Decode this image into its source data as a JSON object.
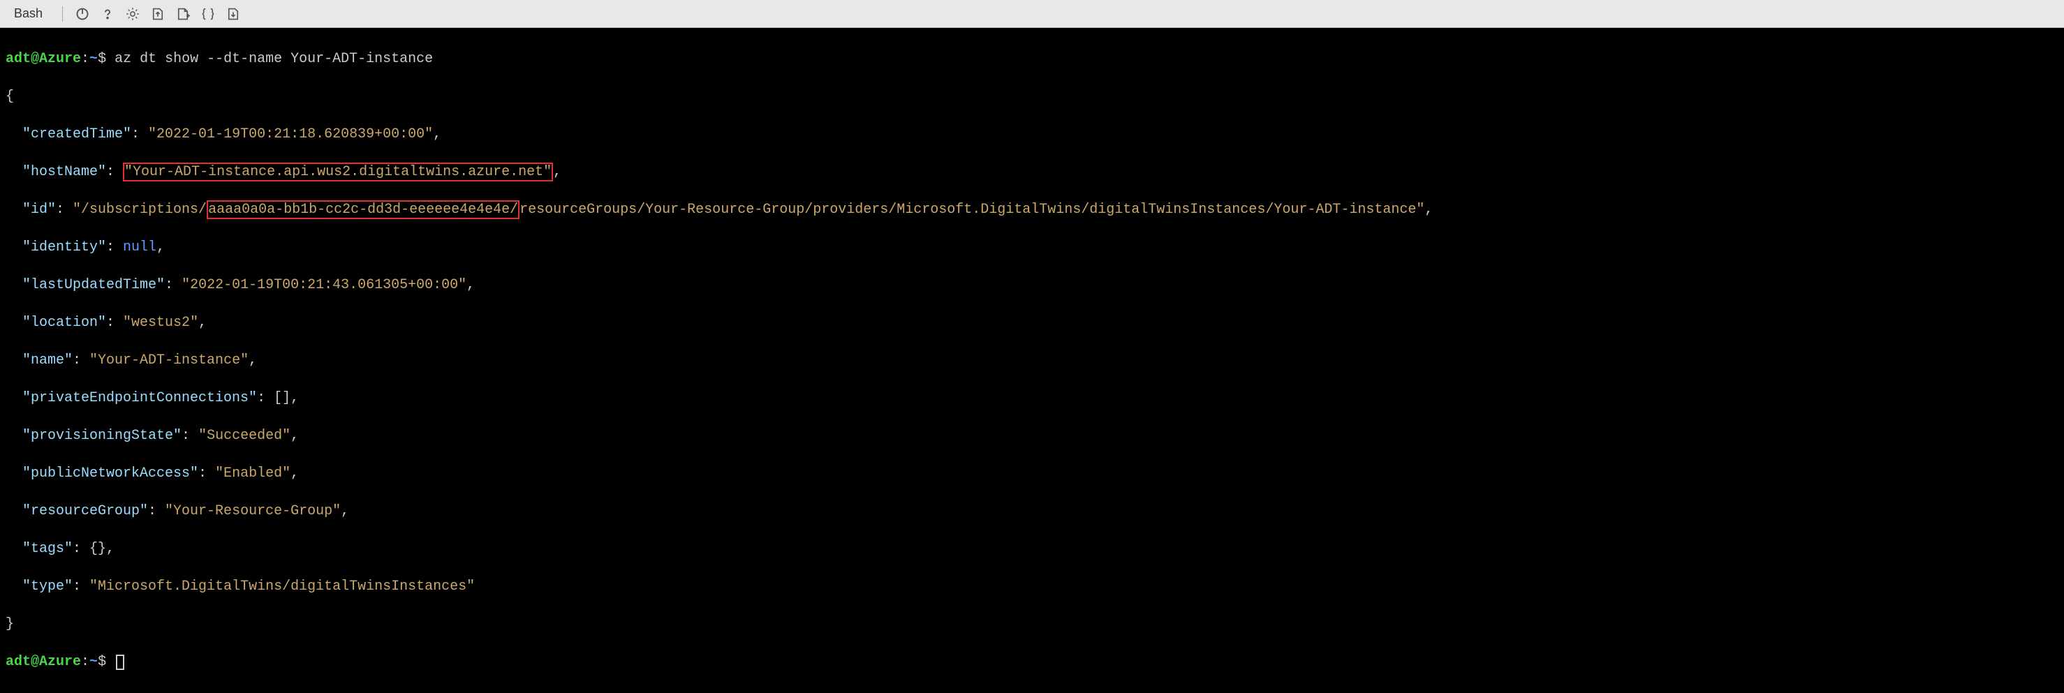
{
  "toolbar": {
    "shell_label": "Bash"
  },
  "prompt": {
    "user_host": "adt@Azure",
    "path": "~",
    "symbol": "$"
  },
  "command": "az dt show --dt-name Your-ADT-instance",
  "output": {
    "createdTime_key": "\"createdTime\"",
    "createdTime_val": "\"2022-01-19T00:21:18.620839+00:00\"",
    "hostName_key": "\"hostName\"",
    "hostName_val": "\"Your-ADT-instance.api.wus2.digitaltwins.azure.net\"",
    "id_key": "\"id\"",
    "id_prefix": "\"/subscriptions/",
    "id_highlight": "aaaa0a0a-bb1b-cc2c-dd3d-eeeeee4e4e4e/",
    "id_suffix": "resourceGroups/Your-Resource-Group/providers/Microsoft.DigitalTwins/digitalTwinsInstances/Your-ADT-instance\"",
    "identity_key": "\"identity\"",
    "identity_val": "null",
    "lastUpdatedTime_key": "\"lastUpdatedTime\"",
    "lastUpdatedTime_val": "\"2022-01-19T00:21:43.061305+00:00\"",
    "location_key": "\"location\"",
    "location_val": "\"westus2\"",
    "name_key": "\"name\"",
    "name_val": "\"Your-ADT-instance\"",
    "privateEndpointConnections_key": "\"privateEndpointConnections\"",
    "privateEndpointConnections_val": "[]",
    "provisioningState_key": "\"provisioningState\"",
    "provisioningState_val": "\"Succeeded\"",
    "publicNetworkAccess_key": "\"publicNetworkAccess\"",
    "publicNetworkAccess_val": "\"Enabled\"",
    "resourceGroup_key": "\"resourceGroup\"",
    "resourceGroup_val": "\"Your-Resource-Group\"",
    "tags_key": "\"tags\"",
    "tags_val": "{}",
    "type_key": "\"type\"",
    "type_val": "\"Microsoft.DigitalTwins/digitalTwinsInstances\""
  }
}
